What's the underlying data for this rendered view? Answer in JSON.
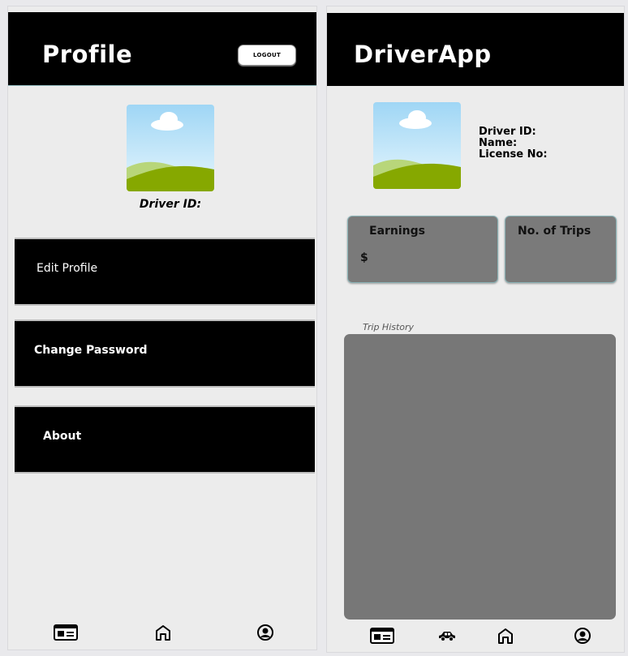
{
  "profile_screen": {
    "header": {
      "title": "Profile",
      "logout_label": "LOGOUT"
    },
    "avatar": {
      "icon": "landscape-placeholder-icon"
    },
    "driver_id_label": "Driver ID:",
    "menu": [
      {
        "label": "Edit Profile"
      },
      {
        "label": "Change Password"
      },
      {
        "label": "About"
      }
    ],
    "bottom_nav": [
      {
        "icon": "id-card-icon"
      },
      {
        "icon": "home-icon"
      },
      {
        "icon": "user-icon"
      }
    ]
  },
  "driver_screen": {
    "header": {
      "title": "DriverApp"
    },
    "avatar": {
      "icon": "landscape-placeholder-icon"
    },
    "driver_info": {
      "driver_id_label": "Driver ID:",
      "name_label": "Name:",
      "license_label": "License No:"
    },
    "stats": {
      "earnings_label": "Earnings",
      "earnings_value": "$",
      "trips_label": "No. of Trips"
    },
    "trip_history_label": "Trip History",
    "bottom_nav": [
      {
        "icon": "id-card-icon"
      },
      {
        "icon": "car-icon"
      },
      {
        "icon": "home-icon"
      },
      {
        "icon": "user-icon"
      }
    ]
  },
  "colors": {
    "header": "#000000",
    "screen_background": "#ececec",
    "card_gray": "#7a7a7a",
    "accent_border": "#8ab3b6"
  }
}
